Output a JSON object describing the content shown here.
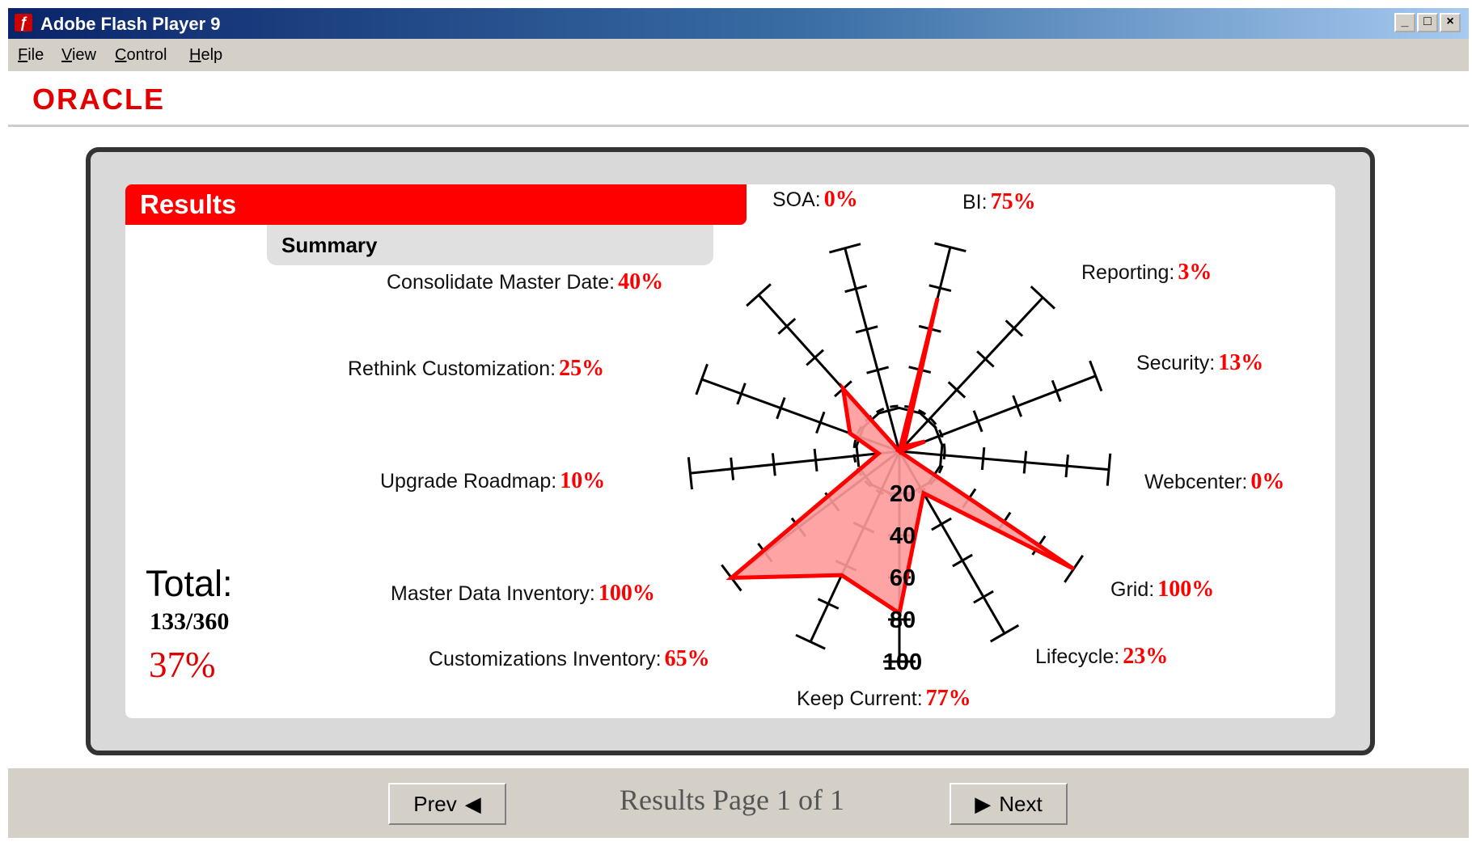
{
  "window": {
    "title": "Adobe Flash Player 9",
    "controls": [
      "_",
      "□",
      "×"
    ]
  },
  "menu": [
    "File",
    "View",
    "Control",
    "Help"
  ],
  "brand": {
    "logo_text": "ORACLE"
  },
  "results": {
    "header": "Results",
    "tab": "Summary",
    "total_label": "Total:",
    "total_fraction": "133/360",
    "total_percent": "37%"
  },
  "chart_data": {
    "type": "radar",
    "scale_ticks": [
      "20",
      "40",
      "60",
      "80",
      "100"
    ],
    "axes": [
      {
        "label": "SOA:",
        "value_text": "0%",
        "value": 0
      },
      {
        "label": "BI:",
        "value_text": "75%",
        "value": 75
      },
      {
        "label": "Reporting:",
        "value_text": "3%",
        "value": 3
      },
      {
        "label": "Security:",
        "value_text": "13%",
        "value": 13
      },
      {
        "label": "Webcenter:",
        "value_text": "0%",
        "value": 0
      },
      {
        "label": "Grid:",
        "value_text": "100%",
        "value": 100
      },
      {
        "label": "Lifecycle:",
        "value_text": "23%",
        "value": 23
      },
      {
        "label": "Keep Current:",
        "value_text": "77%",
        "value": 77
      },
      {
        "label": "Customizations Inventory:",
        "value_text": "65%",
        "value": 65
      },
      {
        "label": "Master Data Inventory:",
        "value_text": "100%",
        "value": 100
      },
      {
        "label": "Upgrade Roadmap:",
        "value_text": "10%",
        "value": 10
      },
      {
        "label": "Rethink  Customization:",
        "value_text": "25%",
        "value": 25
      },
      {
        "label": "Consolidate  Master Date:",
        "value_text": "40%",
        "value": 40
      }
    ]
  },
  "footer": {
    "prev": "Prev",
    "page_text": "Results Page 1 of 1",
    "next": "Next"
  },
  "colors": {
    "accent": "#ff0000",
    "fill": "#ff9a9a"
  }
}
